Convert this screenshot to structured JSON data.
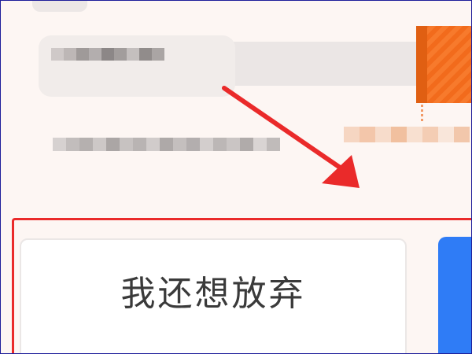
{
  "dialog": {
    "give_up_button_label": "我还想放弃"
  },
  "colors": {
    "accent_orange": "#f77a2c",
    "primary_blue": "#2f7cf6",
    "annotation_red": "#ea2a2a"
  }
}
